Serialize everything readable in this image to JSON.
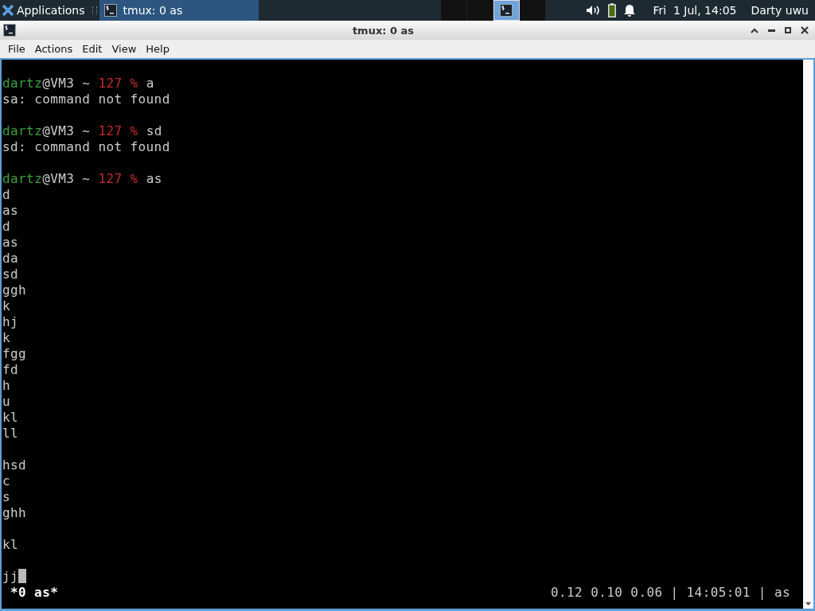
{
  "panel": {
    "apps_menu": "Applications",
    "taskbar": [
      {
        "title": "tmux: 0 as",
        "selected": true
      }
    ],
    "workspaces": [
      {
        "selected": false
      },
      {
        "selected": false
      },
      {
        "selected": true
      },
      {
        "selected": false
      }
    ],
    "clock": "Fri  1 Jul, 14:05",
    "user": "Darty uwu"
  },
  "window": {
    "title": "tmux: 0 as",
    "menu": [
      "File",
      "Actions",
      "Edit",
      "View",
      "Help"
    ]
  },
  "terminal": {
    "lines": [
      {
        "kind": "blank"
      },
      {
        "kind": "prompt",
        "user": "dartz",
        "host": "@VM3",
        "dir": "~",
        "status": "127 %",
        "command": "a"
      },
      {
        "kind": "output",
        "text": "sa: command not found"
      },
      {
        "kind": "blank"
      },
      {
        "kind": "prompt",
        "user": "dartz",
        "host": "@VM3",
        "dir": "~",
        "status": "127 %",
        "command": "sd"
      },
      {
        "kind": "output",
        "text": "sd: command not found"
      },
      {
        "kind": "blank"
      },
      {
        "kind": "prompt",
        "user": "dartz",
        "host": "@VM3",
        "dir": "~",
        "status": "127 %",
        "command": "as"
      },
      {
        "kind": "output",
        "text": "d"
      },
      {
        "kind": "output",
        "text": "as"
      },
      {
        "kind": "output",
        "text": "d"
      },
      {
        "kind": "output",
        "text": "as"
      },
      {
        "kind": "output",
        "text": "da"
      },
      {
        "kind": "output",
        "text": "sd"
      },
      {
        "kind": "output",
        "text": "ggh"
      },
      {
        "kind": "output",
        "text": "k"
      },
      {
        "kind": "output",
        "text": "hj"
      },
      {
        "kind": "output",
        "text": "k"
      },
      {
        "kind": "output",
        "text": "fgg"
      },
      {
        "kind": "output",
        "text": "fd"
      },
      {
        "kind": "output",
        "text": "h"
      },
      {
        "kind": "output",
        "text": "u"
      },
      {
        "kind": "output",
        "text": "kl"
      },
      {
        "kind": "output",
        "text": "ll"
      },
      {
        "kind": "blank"
      },
      {
        "kind": "output",
        "text": "hsd"
      },
      {
        "kind": "output",
        "text": "c"
      },
      {
        "kind": "output",
        "text": "s"
      },
      {
        "kind": "output",
        "text": "ghh"
      },
      {
        "kind": "blank"
      },
      {
        "kind": "output",
        "text": "kl"
      },
      {
        "kind": "blank"
      },
      {
        "kind": "output",
        "text": "jj"
      }
    ],
    "cursor": true,
    "status_left": "*0 as*",
    "status_right": "0.12 0.10 0.06 | 14:05:01 | as"
  }
}
